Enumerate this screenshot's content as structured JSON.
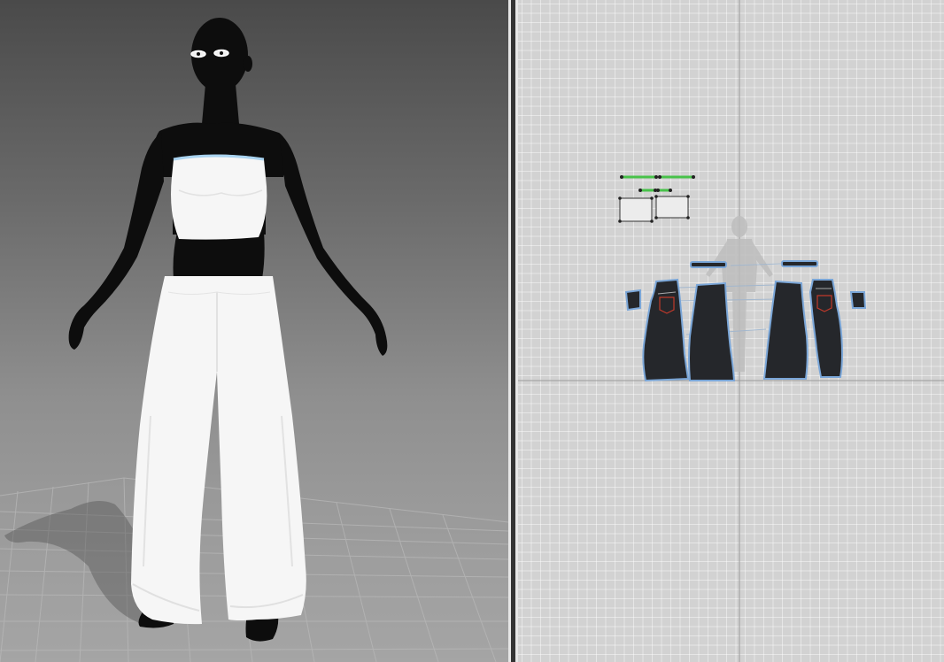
{
  "window": {
    "views": [
      {
        "id": "3d",
        "kind": "3D garment view"
      },
      {
        "id": "2d",
        "kind": "2D pattern window"
      }
    ]
  },
  "colors": {
    "avatar": "#0d0d0d",
    "garment_3d": "#f6f6f6",
    "pattern_fill": "#25272b",
    "pattern_outline": "#7aa6d8",
    "seam_green": "#48c24a",
    "internal_line_red": "#c0392b",
    "grid_bg": "#d2d2d2",
    "axis_line": "#9a9a9a"
  },
  "scene": {
    "avatar": "female-avatar",
    "garments": [
      "tube-top",
      "wide-leg-pants"
    ],
    "pattern_pieces": [
      "waistband-left",
      "waistband-right",
      "pants-front-left",
      "pants-back-left",
      "pants-back-right",
      "pants-front-right",
      "pocket-left",
      "pocket-right",
      "top-front",
      "top-back"
    ]
  }
}
